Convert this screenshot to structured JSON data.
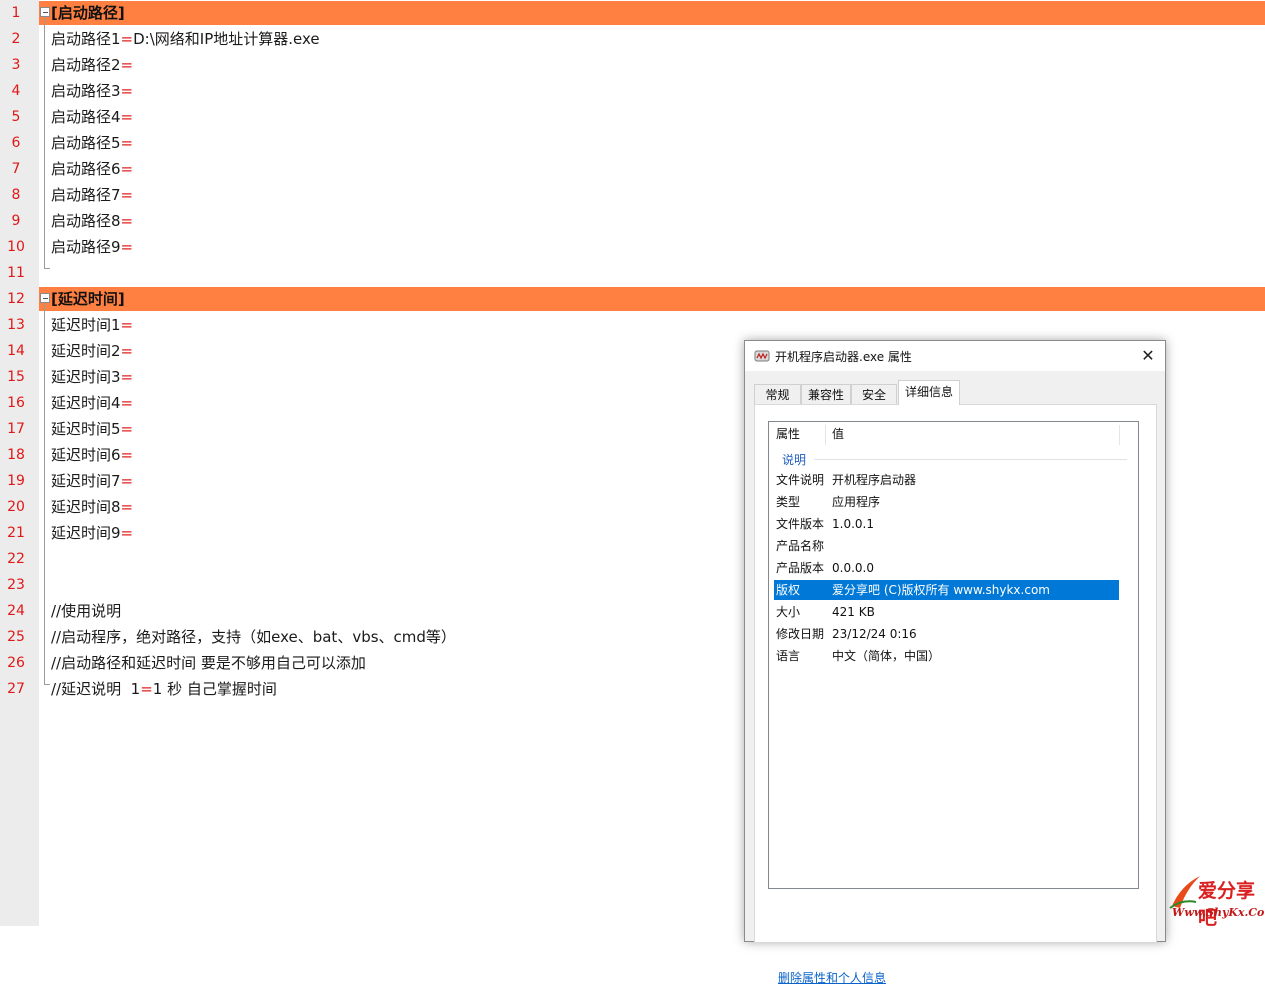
{
  "editor": {
    "lines": [
      {
        "n": "1",
        "key": "[启动路径]",
        "eq": "",
        "val": "",
        "section": true
      },
      {
        "n": "2",
        "key": "启动路径1",
        "eq": "=",
        "val": "D:\\网络和IP地址计算器.exe"
      },
      {
        "n": "3",
        "key": "启动路径2",
        "eq": "=",
        "val": ""
      },
      {
        "n": "4",
        "key": "启动路径3",
        "eq": "=",
        "val": ""
      },
      {
        "n": "5",
        "key": "启动路径4",
        "eq": "=",
        "val": ""
      },
      {
        "n": "6",
        "key": "启动路径5",
        "eq": "=",
        "val": ""
      },
      {
        "n": "7",
        "key": "启动路径6",
        "eq": "=",
        "val": ""
      },
      {
        "n": "8",
        "key": "启动路径7",
        "eq": "=",
        "val": ""
      },
      {
        "n": "9",
        "key": "启动路径8",
        "eq": "=",
        "val": ""
      },
      {
        "n": "10",
        "key": "启动路径9",
        "eq": "=",
        "val": ""
      },
      {
        "n": "11",
        "key": "",
        "eq": "",
        "val": ""
      },
      {
        "n": "12",
        "key": "[延迟时间]",
        "eq": "",
        "val": "",
        "section": true
      },
      {
        "n": "13",
        "key": "延迟时间1",
        "eq": "=",
        "val": ""
      },
      {
        "n": "14",
        "key": "延迟时间2",
        "eq": "=",
        "val": ""
      },
      {
        "n": "15",
        "key": "延迟时间3",
        "eq": "=",
        "val": ""
      },
      {
        "n": "16",
        "key": "延迟时间4",
        "eq": "=",
        "val": ""
      },
      {
        "n": "17",
        "key": "延迟时间5",
        "eq": "=",
        "val": ""
      },
      {
        "n": "18",
        "key": "延迟时间6",
        "eq": "=",
        "val": ""
      },
      {
        "n": "19",
        "key": "延迟时间7",
        "eq": "=",
        "val": ""
      },
      {
        "n": "20",
        "key": "延迟时间8",
        "eq": "=",
        "val": ""
      },
      {
        "n": "21",
        "key": "延迟时间9",
        "eq": "=",
        "val": ""
      },
      {
        "n": "22",
        "key": "",
        "eq": "",
        "val": ""
      },
      {
        "n": "23",
        "key": "",
        "eq": "",
        "val": ""
      },
      {
        "n": "24",
        "key": "//使用说明",
        "eq": "",
        "val": ""
      },
      {
        "n": "25",
        "key": "//启动程序，绝对路径，支持（如exe、bat、vbs、cmd等）",
        "eq": "",
        "val": ""
      },
      {
        "n": "26",
        "key": "//启动路径和延迟时间 要是不够用自己可以添加",
        "eq": "",
        "val": ""
      },
      {
        "n": "27",
        "key": "//延迟说明  1",
        "eq": "=",
        "val": "1 秒 自己掌握时间"
      }
    ]
  },
  "dialog": {
    "title": "开机程序启动器.exe 属性",
    "close": "✕",
    "tabs": [
      "常规",
      "兼容性",
      "安全",
      "详细信息"
    ],
    "active_tab": "详细信息",
    "header": {
      "property": "属性",
      "value": "值"
    },
    "group": "说明",
    "rows": [
      {
        "k": "文件说明",
        "v": "开机程序启动器"
      },
      {
        "k": "类型",
        "v": "应用程序"
      },
      {
        "k": "文件版本",
        "v": "1.0.0.1"
      },
      {
        "k": "产品名称",
        "v": ""
      },
      {
        "k": "产品版本",
        "v": "0.0.0.0"
      },
      {
        "k": "版权",
        "v": "爱分享吧 (C)版权所有 www.shykx.com",
        "selected": true
      },
      {
        "k": "大小",
        "v": "421 KB"
      },
      {
        "k": "修改日期",
        "v": "23/12/24 0:16"
      },
      {
        "k": "语言",
        "v": "中文（简体，中国）"
      }
    ],
    "remove_link": "删除属性和个人信息"
  },
  "watermark": {
    "name": "爱分享吧",
    "url": "Www.ShyKx.Com"
  },
  "colors": {
    "section_highlight": "#ff8040",
    "line_number": "#e01818",
    "selection": "#0078d7",
    "link": "#0a63c9"
  }
}
